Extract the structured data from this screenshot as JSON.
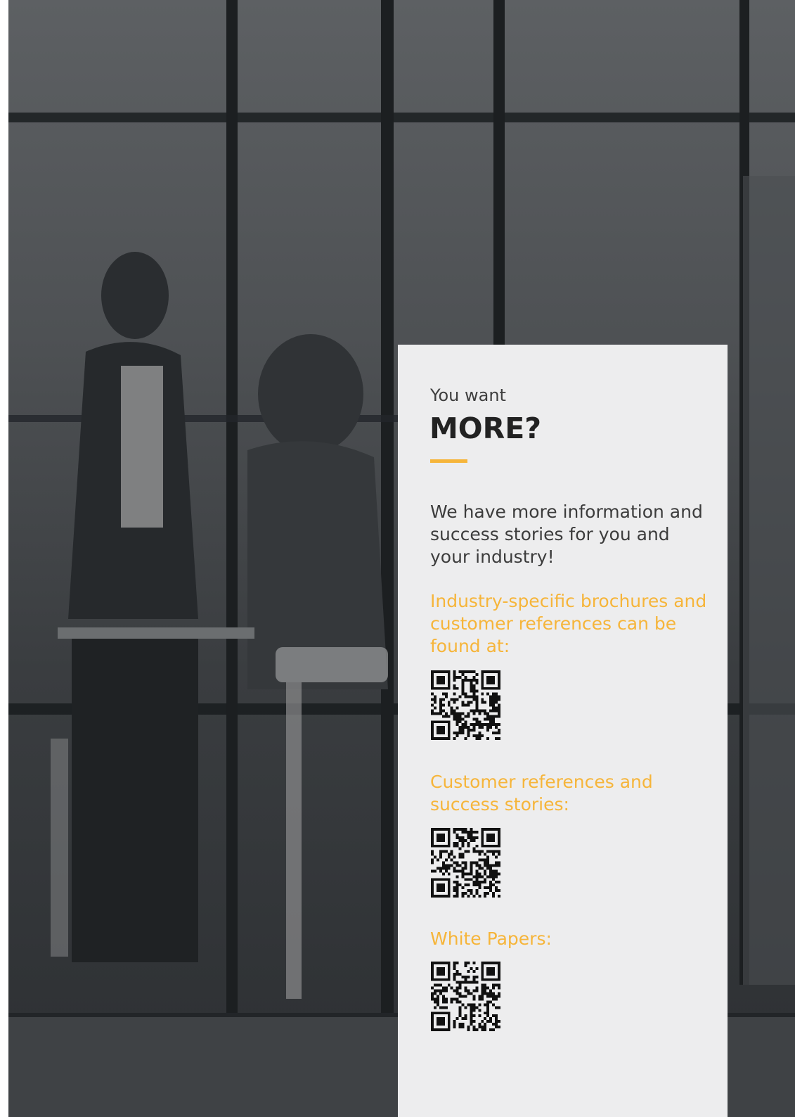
{
  "panel": {
    "intro": "You want",
    "headline": "MORE?",
    "body": "We have more information and success stories for you and your industry!",
    "sections": [
      {
        "label": "Industry-specific brochures and customer references can be found at:",
        "qr_icon": "qr-code-icon"
      },
      {
        "label": "Customer references and success stories:",
        "qr_icon": "qr-code-icon"
      },
      {
        "label": "White Papers:",
        "qr_icon": "qr-code-icon"
      }
    ]
  },
  "colors": {
    "accent": "#f6b53a",
    "panel_background": "#ededee",
    "headline": "#222222",
    "body_text": "#3c3c3c"
  }
}
